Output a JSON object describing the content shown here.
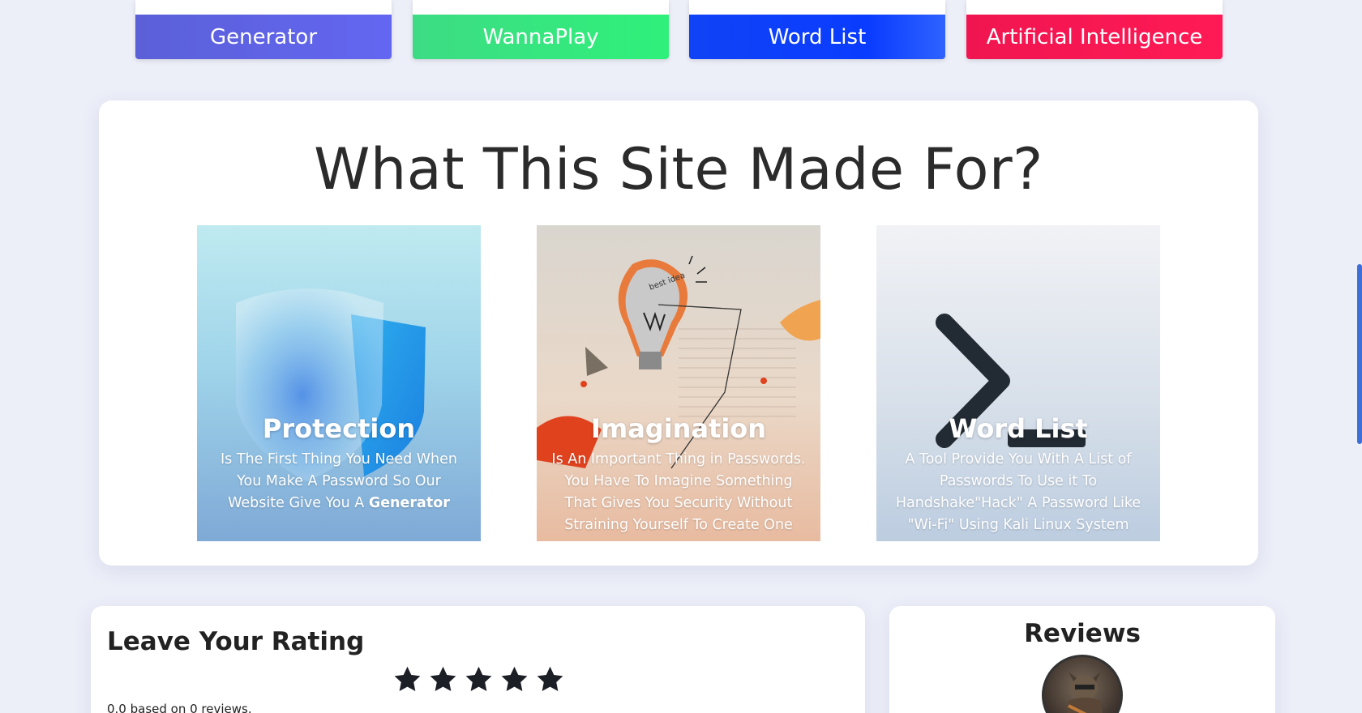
{
  "tools": [
    {
      "label": "Generator",
      "color": "#5b60d8"
    },
    {
      "label": "WannaPlay",
      "color": "#2ff07a"
    },
    {
      "label": "Word List",
      "color": "#0a3cff"
    },
    {
      "label": "Artificial Intelligence",
      "color": "#ff1a55"
    }
  ],
  "about": {
    "title": "What This Site Made For?",
    "features": [
      {
        "title": "Protection",
        "desc": "Is The First Thing You Need When You Make A Password So Our Website Give You A ",
        "desc_bold": "Generator",
        "icon": "shield-icon"
      },
      {
        "title": "Imagination",
        "desc": "Is An Important Thing in Passwords. You Have To Imagine Something That Gives You Security Without Straining Yourself To Create One",
        "icon": "lightbulb-icon",
        "art_text": [
          "best",
          "idea"
        ]
      },
      {
        "title": "Word List",
        "desc": "A Tool Provide You With A List of Passwords To Use it To Handshake\"Hack\" A Password Like \"Wi-Fi\" Using Kali Linux System",
        "icon": "terminal-prompt-icon"
      }
    ]
  },
  "rating": {
    "title": "Leave Your Rating",
    "stars": 5,
    "summary": "0.0 based on 0 reviews."
  },
  "reviews": {
    "title": "Reviews",
    "avatar_icon": "raccoon-avatar"
  }
}
